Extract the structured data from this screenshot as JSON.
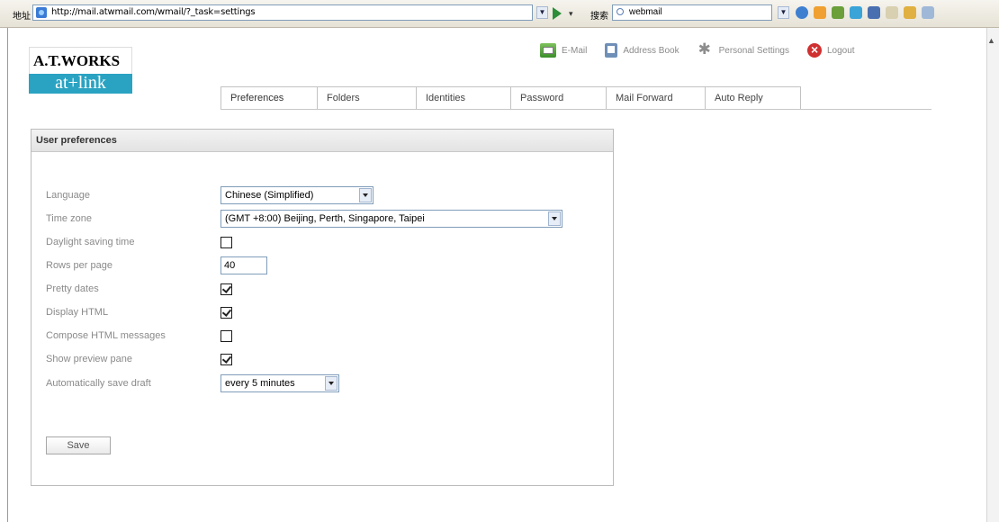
{
  "browser": {
    "address_label": "地址",
    "url": "http://mail.atwmail.com/wmail/?_task=settings",
    "search_label": "搜索",
    "search_value": "webmail"
  },
  "logo": {
    "top": "A.T.WORKS",
    "bottom": "at+link"
  },
  "topnav": [
    {
      "label": "E-Mail",
      "icon": "mail-icon"
    },
    {
      "label": "Address Book",
      "icon": "address-book-icon"
    },
    {
      "label": "Personal Settings",
      "icon": "gear-icon"
    },
    {
      "label": "Logout",
      "icon": "logout-icon"
    }
  ],
  "tabs": [
    {
      "label": "Preferences",
      "selected": true
    },
    {
      "label": "Folders"
    },
    {
      "label": "Identities"
    },
    {
      "label": "Password"
    },
    {
      "label": "Mail Forward"
    },
    {
      "label": "Auto Reply"
    }
  ],
  "panel": {
    "title": "User preferences",
    "language": {
      "label": "Language",
      "value": "Chinese (Simplified)"
    },
    "timezone": {
      "label": "Time zone",
      "value": "(GMT +8:00) Beijing, Perth, Singapore, Taipei"
    },
    "dst": {
      "label": "Daylight saving time",
      "checked": false
    },
    "rows_per_page": {
      "label": "Rows per page",
      "value": "40"
    },
    "pretty_dates": {
      "label": "Pretty dates",
      "checked": true
    },
    "display_html": {
      "label": "Display HTML",
      "checked": true
    },
    "compose_html": {
      "label": "Compose HTML messages",
      "checked": false
    },
    "preview_pane": {
      "label": "Show preview pane",
      "checked": true
    },
    "save_draft": {
      "label": "Automatically save draft",
      "value": "every 5 minutes"
    },
    "save_button": "Save"
  },
  "colors": {
    "logo_accent": "#2aa3c2",
    "border": "#bcbcbc"
  }
}
